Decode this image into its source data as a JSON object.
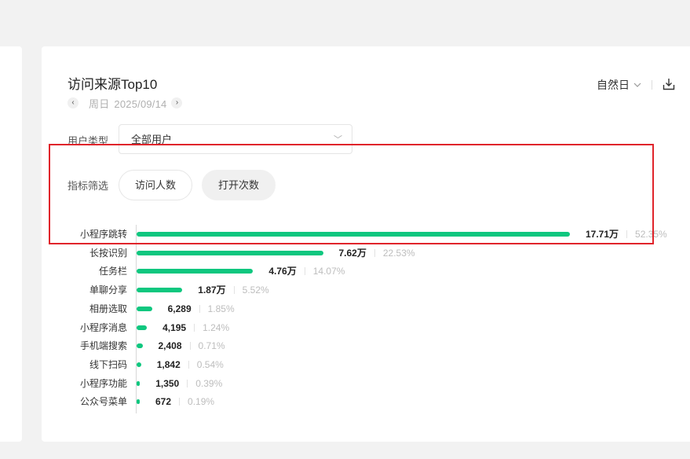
{
  "card": {
    "title": "访问来源Top10",
    "date_weekday": "周日",
    "date_value": "2025/09/14",
    "period_label": "自然日"
  },
  "filters": {
    "user_type_label": "用户类型",
    "user_type_value": "全部用户",
    "metric_label": "指标筛选",
    "metric_options": [
      "访问人数",
      "打开次数"
    ],
    "metric_selected": "打开次数"
  },
  "colors": {
    "bar": "#0fc77f",
    "highlight_box": "#e0242b"
  },
  "icons": {
    "prev": "chevron-left-icon",
    "next": "chevron-right-icon",
    "period_dropdown": "chevron-down-icon",
    "download": "download-icon",
    "select_dropdown": "chevron-down-icon"
  },
  "chart_data": {
    "type": "bar",
    "orientation": "horizontal",
    "categories": [
      "小程序跳转",
      "长按识别",
      "任务栏",
      "单聊分享",
      "相册选取",
      "小程序消息",
      "手机端搜索",
      "线下扫码",
      "小程序功能",
      "公众号菜单"
    ],
    "values": [
      177100,
      76200,
      47600,
      18700,
      6289,
      4195,
      2408,
      1842,
      1350,
      672
    ],
    "value_labels": [
      "17.71万",
      "7.62万",
      "4.76万",
      "1.87万",
      "6,289",
      "4,195",
      "2,408",
      "1,842",
      "1,350",
      "672"
    ],
    "percent_labels": [
      "52.35%",
      "22.53%",
      "14.07%",
      "5.52%",
      "1.85%",
      "1.24%",
      "0.71%",
      "0.54%",
      "0.39%",
      "0.19%"
    ],
    "xlim": [
      0,
      177100
    ],
    "grid": false
  }
}
